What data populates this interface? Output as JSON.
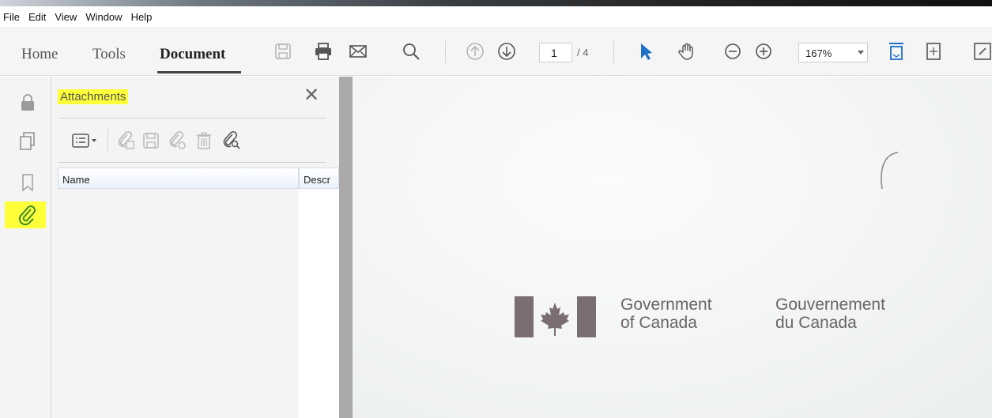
{
  "menu": [
    "File",
    "Edit",
    "View",
    "Window",
    "Help"
  ],
  "tabs": {
    "home": "Home",
    "tools": "Tools",
    "document": "Document"
  },
  "page_nav": {
    "current": "1",
    "total": "/ 4"
  },
  "zoom": "167%",
  "panel": {
    "title": "Attachments",
    "close": "✕"
  },
  "table": {
    "col_name": "Name",
    "col_desc": "Descr"
  },
  "document": {
    "gov_en": "Government\nof Canada",
    "gov_fr": "Gouvernement\ndu Canada"
  },
  "colors": {
    "highlight": "#ffff3a",
    "accent": "#1e6fc8",
    "attach_icon": "#3c8a2e"
  },
  "icons": [
    "save-icon",
    "print-icon",
    "email-icon",
    "search-icon",
    "prev-page-icon",
    "next-page-icon",
    "select-cursor-icon",
    "hand-tool-icon",
    "zoom-out-icon",
    "zoom-in-icon",
    "fit-page-icon",
    "fit-width-icon",
    "lock-icon",
    "pages-icon",
    "bookmark-icon",
    "paperclip-icon",
    "options-menu-icon",
    "add-attachment-icon",
    "save-attachment-icon",
    "open-attachment-icon",
    "delete-attachment-icon",
    "search-attachment-icon"
  ]
}
